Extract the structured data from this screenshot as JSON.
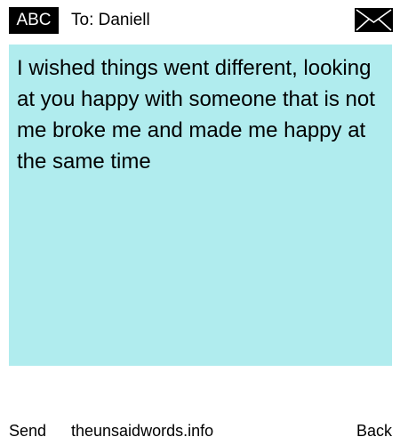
{
  "header": {
    "input_mode": "ABC",
    "recipient_line": "To: Daniell",
    "icon": "envelope-icon"
  },
  "message": {
    "text": "I wished things went different, looking at you happy with someone that is not me broke me and made me happy at the same time"
  },
  "footer": {
    "send_label": "Send",
    "site_label": "theunsaidwords.info",
    "back_label": "Back"
  },
  "colors": {
    "message_background": "#b0ecee",
    "badge_background": "#000000",
    "page_background": "#ffffff"
  }
}
